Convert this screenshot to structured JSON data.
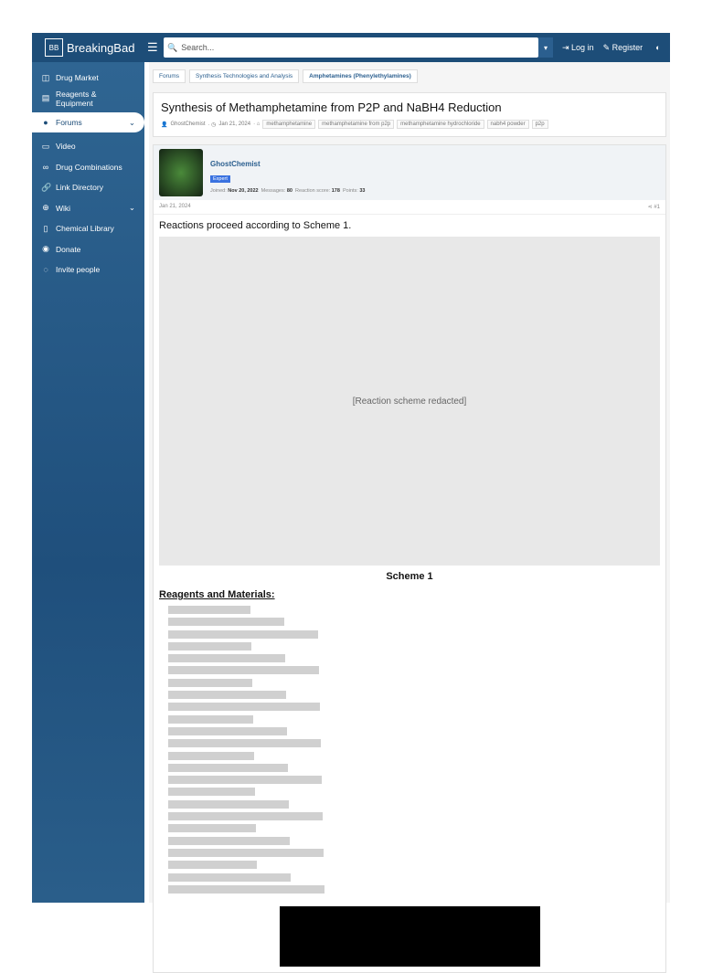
{
  "header": {
    "logo": "BreakingBad",
    "logo_mark": "BB",
    "search_placeholder": "Search...",
    "login": "Log in",
    "register": "Register"
  },
  "sidebar": {
    "items": [
      {
        "label": "Drug Market",
        "icon": "market-icon"
      },
      {
        "label": "Reagents & Equipment",
        "icon": "flask-icon"
      },
      {
        "label": "Forums",
        "icon": "forum-icon"
      },
      {
        "label": "Video",
        "icon": "video-icon"
      },
      {
        "label": "Drug Combinations",
        "icon": "pills-icon"
      },
      {
        "label": "Link Directory",
        "icon": "link-icon"
      },
      {
        "label": "Wiki",
        "icon": "globe-icon"
      },
      {
        "label": "Chemical Library",
        "icon": "book-icon"
      },
      {
        "label": "Donate",
        "icon": "donate-icon"
      },
      {
        "label": "Invite people",
        "icon": "invite-icon"
      }
    ]
  },
  "breadcrumbs": [
    "Forums",
    "Synthesis Technologies and Analysis",
    "Amphetamines (Phenylethylamines)"
  ],
  "thread": {
    "title": "Synthesis of Methamphetamine from P2P and NaBH4 Reduction",
    "author": "GhostChemist",
    "date": "Jan 21, 2024",
    "tags": [
      "methamphetamine",
      "methamphetamine from p2p",
      "methamphetamine hydrochloride",
      "nabh4 powder",
      "p2p"
    ]
  },
  "post": {
    "author": "GhostChemist",
    "badge": "Expert",
    "joined_label": "Joined:",
    "joined": "Nov 20, 2022",
    "messages_label": "Messages:",
    "messages": "80",
    "score_label": "Reaction score:",
    "score": "178",
    "points_label": "Points:",
    "points": "33",
    "date": "Jan 21, 2024",
    "number": "#1",
    "intro": "Reactions proceed according to Scheme 1.",
    "scheme_caption": "Scheme 1",
    "reagents_heading": "Reagents and Materials:",
    "redacted_note": "[Reaction scheme redacted]"
  }
}
